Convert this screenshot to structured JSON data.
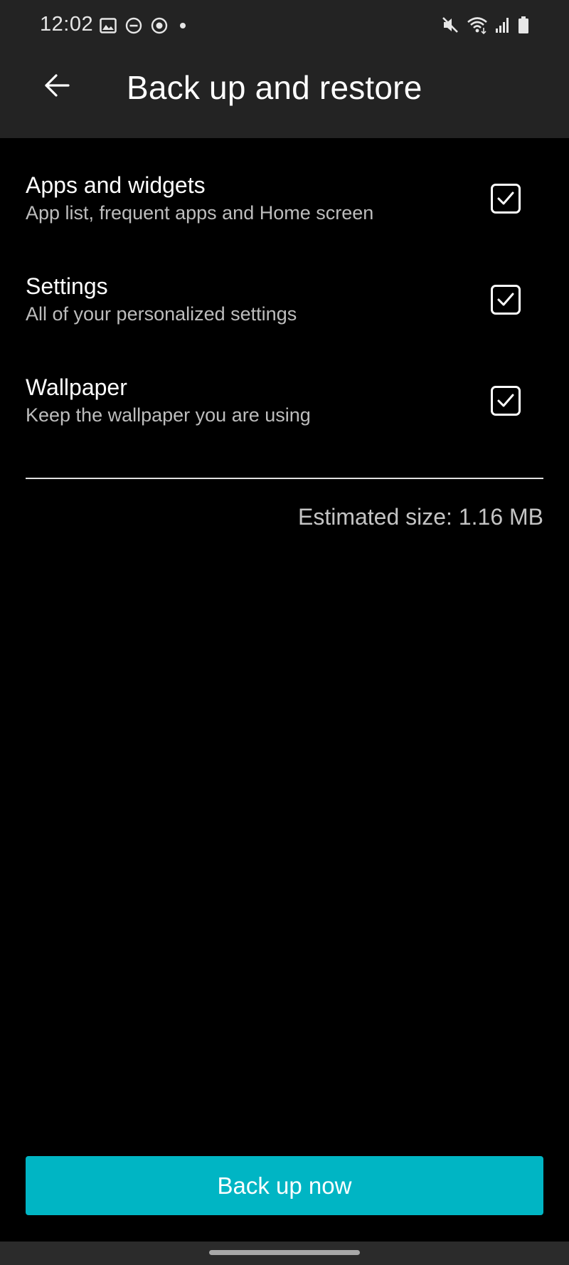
{
  "status_bar": {
    "time": "12:02",
    "left_icons": [
      "image-icon",
      "do-not-disturb-icon",
      "media-icon",
      "dot-icon"
    ],
    "right_icons": [
      "mute-icon",
      "wifi-icon",
      "signal-icon",
      "battery-icon"
    ]
  },
  "header": {
    "title": "Back up and restore",
    "back_icon": "arrow-back-icon"
  },
  "options": [
    {
      "title": "Apps and widgets",
      "subtitle": "App list, frequent apps and Home screen",
      "checked": true
    },
    {
      "title": "Settings",
      "subtitle": "All of your personalized settings",
      "checked": true
    },
    {
      "title": "Wallpaper",
      "subtitle": "Keep the wallpaper you are using",
      "checked": true
    }
  ],
  "estimated_size": "Estimated size: 1.16 MB",
  "action": {
    "backup_label": "Back up now"
  },
  "colors": {
    "background": "#000000",
    "header_background": "#232323",
    "accent": "#00b5c4",
    "subtitle_text": "#bdbdbd"
  }
}
